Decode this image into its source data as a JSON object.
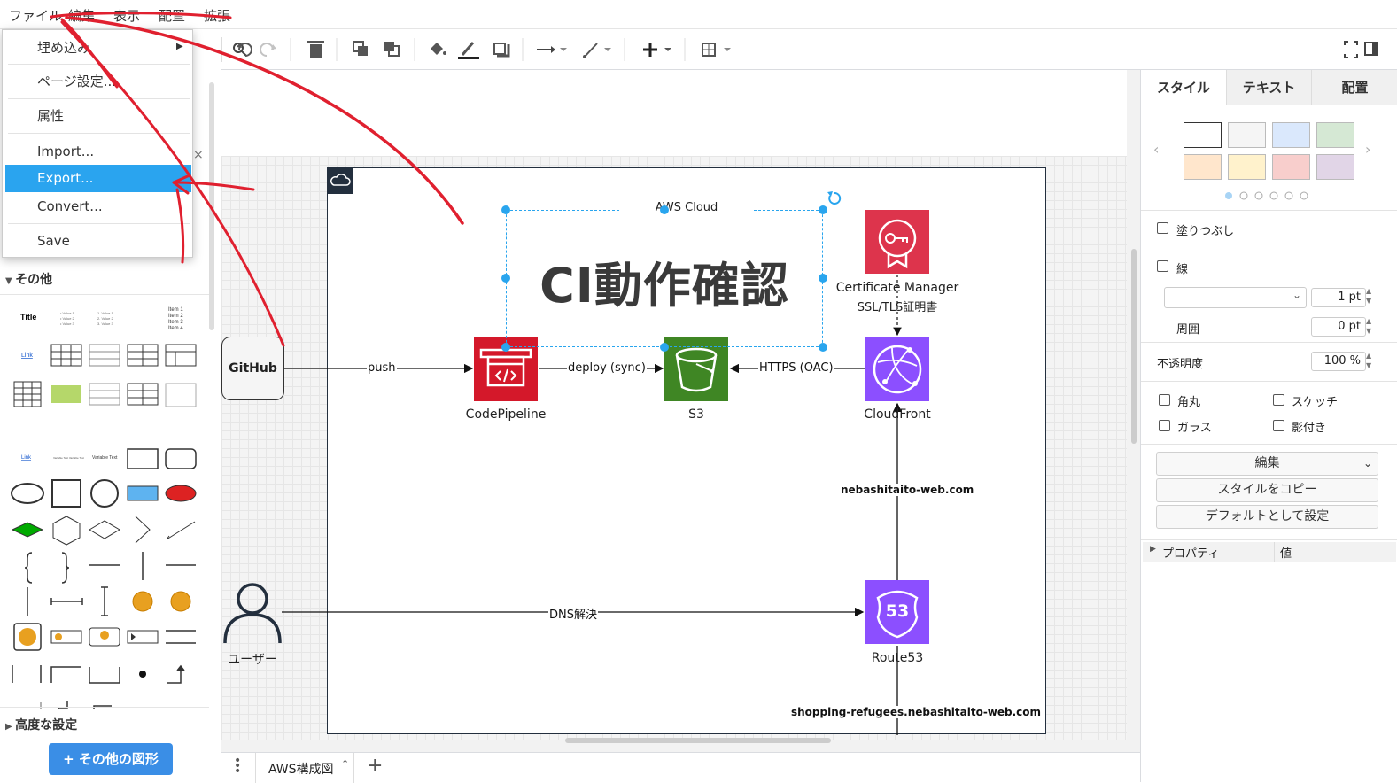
{
  "menubar": {
    "items": [
      "ファイル",
      "編集",
      "表示",
      "配置",
      "拡張"
    ]
  },
  "file_menu": {
    "items": [
      "埋め込み",
      "ページ設定...",
      "属性",
      "Import...",
      "Export...",
      "Convert...",
      "Save"
    ],
    "selected": "Export..."
  },
  "sidebar": {
    "section_other": "その他",
    "section_advanced": "高度な設定",
    "more_shapes_button": "+ その他の図形",
    "shape_title": "Title",
    "shape_link": "Link",
    "shape_variable_text": "Variable Text",
    "shape_items": [
      "Item 1",
      "Item 2",
      "Item 3",
      "Item 4"
    ]
  },
  "diagram": {
    "group_label": "AWS Cloud",
    "title": "CI動作確認",
    "nodes": {
      "github": "GitHub",
      "codepipeline": "CodePipeline",
      "s3": "S3",
      "cloudfront": "CloudFront",
      "cert_manager_line1": "Certificate Manager",
      "cert_manager_line2": "SSL/TLS証明書",
      "route53": "Route53",
      "route53_badge": "53",
      "user": "ユーザー"
    },
    "edges": {
      "push": "push",
      "deploy": "deploy (sync)",
      "https": "HTTPS (OAC)",
      "dns": "DNS解決",
      "domain1": "nebashitaito-web.com",
      "domain2": "shopping-refugees.nebashitaito-web.com"
    }
  },
  "right_panel": {
    "tabs": [
      "スタイル",
      "テキスト",
      "配置"
    ],
    "swatch_colors": [
      "#ffffff",
      "#f5f5f5",
      "#dae8fc",
      "#d5e8d4",
      "#ffe6cc",
      "#fff2cc",
      "#f8cecc",
      "#e1d5e7"
    ],
    "fill_label": "塗りつぶし",
    "line_label": "線",
    "line_width": "1 pt",
    "perimeter_label": "周囲",
    "perimeter_value": "0 pt",
    "opacity_label": "不透明度",
    "opacity_value": "100 %",
    "checks": [
      "角丸",
      "スケッチ",
      "ガラス",
      "影付き"
    ],
    "edit_label": "編集",
    "copy_style": "スタイルをコピー",
    "set_default": "デフォルトとして設定",
    "prop_col1": "プロパティ",
    "prop_col2": "値"
  },
  "bottom": {
    "page_tab": "AWS構成図"
  },
  "colors": {
    "accent": "#2aa4ef",
    "codepipeline": "#d4182a",
    "s3": "#3f8624",
    "cloudfront": "#8c4fff",
    "cert": "#dd344c",
    "route53": "#8c4fff",
    "annotation": "#e0202f"
  }
}
